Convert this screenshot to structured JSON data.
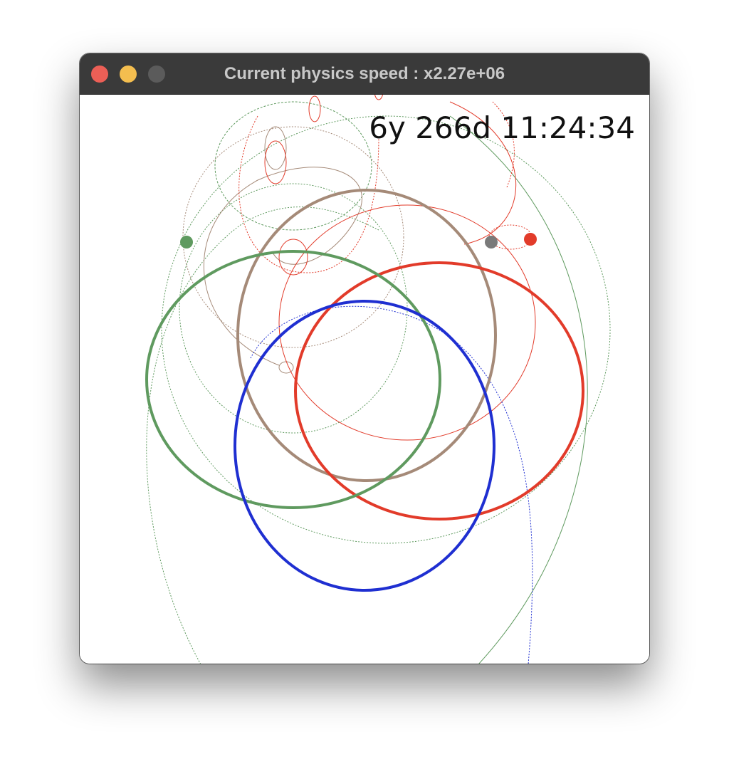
{
  "window": {
    "title": "Current physics speed : x2.27e+06",
    "controls": {
      "close": "close-button",
      "minimize": "minimize-button",
      "zoom": "zoom-button"
    }
  },
  "simulation": {
    "elapsed_time": "6y 266d 11:24:34",
    "colors": {
      "green": "#5f9a5f",
      "brown": "#a58a78",
      "red": "#e23b2a",
      "blue": "#1f2fd1",
      "gray": "#7a7a7a"
    }
  }
}
